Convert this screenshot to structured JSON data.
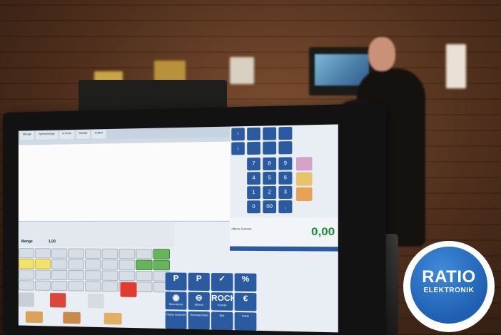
{
  "scene": {
    "description_text": "",
    "background_color": "#4a2a17"
  },
  "pos_screen": {
    "tabs": [
      "Menge",
      "Speiseberge",
      "S Preis",
      "Rabatt",
      "Artikel"
    ],
    "quantity_label": "Menge",
    "quantity_value": "1,00",
    "total_label": "offene Summe",
    "total_value": "0,00",
    "keypad_numbers": [
      "7",
      "8",
      "9",
      "4",
      "5",
      "6",
      "1",
      "2",
      "3",
      "0",
      "00",
      ","
    ],
    "function_keys": [
      {
        "glyph": "P",
        "label": ""
      },
      {
        "glyph": "P",
        "label": ""
      },
      {
        "glyph": "✓",
        "label": ""
      },
      {
        "glyph": "%",
        "label": ""
      },
      {
        "glyph": "◉",
        "label": "Stornieren"
      },
      {
        "glyph": "⊖",
        "label": "Storno"
      },
      {
        "glyph": "ROCK",
        "label": "Kunde"
      },
      {
        "glyph": "€",
        "label": ""
      },
      {
        "glyph": "",
        "label": "Fiskal Zentrum"
      },
      {
        "glyph": "",
        "label": "Tischwechsel"
      },
      {
        "glyph": "",
        "label": "Bar"
      },
      {
        "glyph": "",
        "label": "Karte"
      }
    ],
    "accent_color": "#2a5aa0",
    "total_color": "#1f8a3a"
  },
  "logo": {
    "brand": "RATIO",
    "sub": "ELEKTRONIK",
    "color": "#1f5fb2"
  }
}
